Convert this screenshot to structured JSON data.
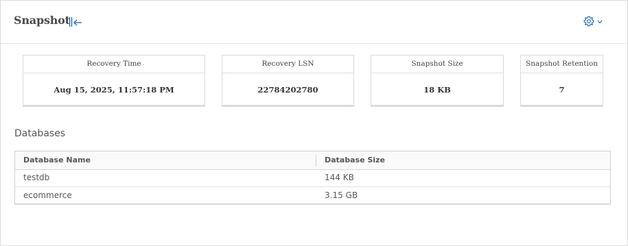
{
  "header": {
    "title": "Snapshot",
    "collapse_icon": "collapse-left-icon",
    "settings_icon": "gear-icon",
    "settings_dropdown_icon": "chevron-down-icon"
  },
  "cards": [
    {
      "label": "Recovery Time",
      "value": "Aug 15, 2025, 11:57:18 PM"
    },
    {
      "label": "Recovery LSN",
      "value": "22784202780"
    },
    {
      "label": "Snapshot Size",
      "value": "18 KB"
    },
    {
      "label": "Snapshot Retention",
      "value": "7"
    }
  ],
  "databases": {
    "title": "Databases",
    "columns": [
      "Database Name",
      "Database Size"
    ],
    "rows": [
      {
        "name": "testdb",
        "size": "144 KB"
      },
      {
        "name": "ecommerce",
        "size": "3.15 GB"
      }
    ]
  },
  "colors": {
    "accent": "#2a6eb5",
    "border": "#d9d9d9"
  }
}
